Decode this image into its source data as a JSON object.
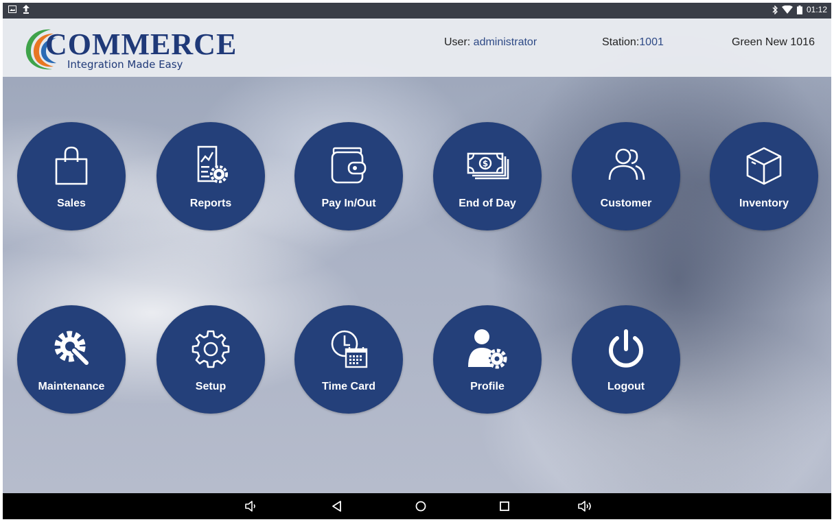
{
  "status_bar": {
    "time": "01:12",
    "left_icons": [
      "image-notification-icon",
      "upload-icon"
    ],
    "right_icons": [
      "bluetooth-icon",
      "wifi-icon",
      "battery-icon"
    ]
  },
  "header": {
    "logo_word": "COMMERCE",
    "logo_tagline": "Integration Made Easy",
    "user_label": "User: ",
    "user_value": "administrator",
    "station_label": "Station:",
    "station_value": "1001",
    "store_name": "Green New 1016"
  },
  "tiles": [
    {
      "label": "Sales",
      "icon": "shopping-bag-icon"
    },
    {
      "label": "Reports",
      "icon": "report-gear-icon"
    },
    {
      "label": "Pay In/Out",
      "icon": "wallet-icon"
    },
    {
      "label": "End of Day",
      "icon": "cash-stack-icon"
    },
    {
      "label": "Customer",
      "icon": "users-icon"
    },
    {
      "label": "Inventory",
      "icon": "box-icon"
    },
    {
      "label": "Maintenance",
      "icon": "wrench-gear-icon"
    },
    {
      "label": "Setup",
      "icon": "gear-icon"
    },
    {
      "label": "Time Card",
      "icon": "clock-calendar-icon"
    },
    {
      "label": "Profile",
      "icon": "user-gear-icon"
    },
    {
      "label": "Logout",
      "icon": "power-icon"
    }
  ],
  "nav_bar": [
    "volume-down-icon",
    "back-icon",
    "home-icon",
    "recents-icon",
    "volume-up-icon"
  ],
  "colors": {
    "tile": "#24407a",
    "accent": "#2e4a86"
  }
}
